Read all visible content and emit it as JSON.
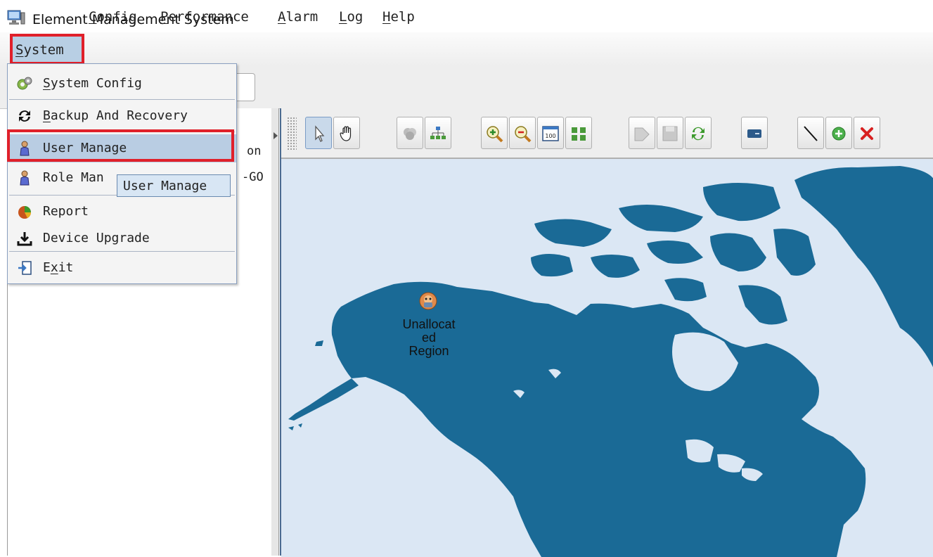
{
  "window": {
    "title": "Element Management System",
    "icon": "computer-icon"
  },
  "menubar": {
    "items": [
      {
        "label": "System",
        "mnemonic": "S",
        "rest": "ystem"
      },
      {
        "label": "Config",
        "mnemonic": "C",
        "rest": "onfig"
      },
      {
        "label": "Performance",
        "mnemonic": "P",
        "rest": "erformance"
      },
      {
        "label": "Alarm",
        "mnemonic": "A",
        "rest": "larm"
      },
      {
        "label": "Log",
        "mnemonic": "L",
        "rest": "og"
      },
      {
        "label": "Help",
        "mnemonic": "H",
        "rest": "elp"
      }
    ]
  },
  "system_menu": {
    "items": [
      {
        "label": "System Config",
        "mnemonic": "S",
        "rest": "ystem Config",
        "icon": "gears-icon"
      },
      {
        "label": "Backup And Recovery",
        "mnemonic": "B",
        "rest": "ackup And Recovery",
        "icon": "refresh-icon"
      },
      {
        "label": "User Manage",
        "icon": "user-icon",
        "highlighted": true
      },
      {
        "label": "Role Man",
        "icon": "user-icon"
      },
      {
        "label": "Report",
        "icon": "report-icon"
      },
      {
        "label": "Device Upgrade",
        "icon": "download-icon"
      },
      {
        "label": "Exit",
        "mnemonic_prefix": "E",
        "mnemonic": "x",
        "rest": "it",
        "icon": "exit-icon"
      }
    ]
  },
  "tooltip": {
    "text": "User Manage"
  },
  "left_panel": {
    "visible_text_1": "on",
    "visible_text_2": "-GO"
  },
  "map": {
    "region_label": "Unallocat\ned\nRegion",
    "region_icon": "region-icon",
    "land_color": "#1a6a96",
    "water_color": "#dbe7f4"
  },
  "toolbar": {
    "buttons": [
      "select-arrow-icon",
      "pan-hand-icon",
      "cluster-icon",
      "topology-icon",
      "zoom-in-icon",
      "zoom-out-icon",
      "zoom-100-icon",
      "fit-grid-icon",
      "tag-icon",
      "save-icon",
      "refresh-icon",
      "device-icon",
      "draw-line-icon",
      "add-icon",
      "delete-icon"
    ],
    "zoom_label": "100"
  }
}
